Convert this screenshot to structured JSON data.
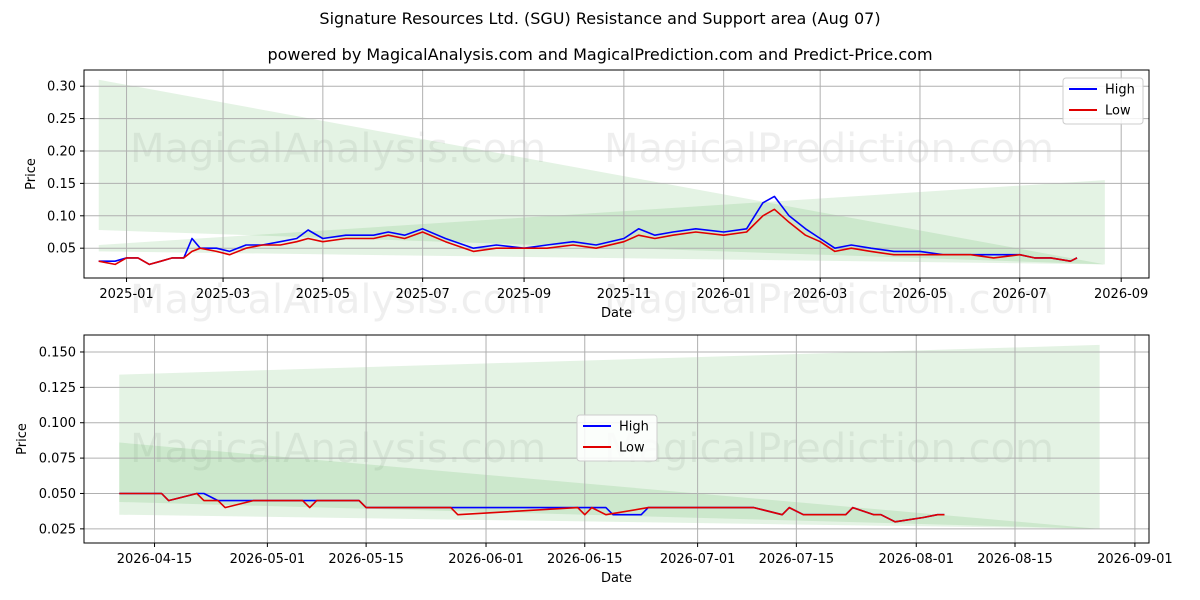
{
  "title": "Signature Resources Ltd. (SGU) Resistance and Support area (Aug 07)",
  "subtitle": "powered by MagicalAnalysis.com and MagicalPrediction.com and Predict-Price.com",
  "watermarks": [
    "MagicalAnalysis.com",
    "MagicalPrediction.com"
  ],
  "colors": {
    "high": "#0000ff",
    "low": "#e00000",
    "band": "#2ca02c",
    "grid": "#b0b0b0"
  },
  "chart_data": [
    {
      "type": "line",
      "xlabel": "Date",
      "ylabel": "Price",
      "x_type": "date",
      "xlim": [
        "2024-12-06",
        "2026-09-18"
      ],
      "ylim": [
        0.004,
        0.325
      ],
      "xticks": [
        "2025-01",
        "2025-03",
        "2025-05",
        "2025-07",
        "2025-09",
        "2025-11",
        "2026-01",
        "2026-03",
        "2026-05",
        "2026-07",
        "2026-09"
      ],
      "xtick_dates": [
        "2025-01-01",
        "2025-03-01",
        "2025-05-01",
        "2025-07-01",
        "2025-09-01",
        "2025-11-01",
        "2026-01-01",
        "2026-03-01",
        "2026-05-01",
        "2026-07-01",
        "2026-09-01"
      ],
      "yticks": [
        0.05,
        0.1,
        0.15,
        0.2,
        0.25,
        0.3
      ],
      "ytick_labels": [
        "0.05",
        "0.10",
        "0.15",
        "0.20",
        "0.25",
        "0.30"
      ],
      "grid": true,
      "legend_position": "top-right",
      "bands": [
        {
          "x": [
            "2024-12-15",
            "2026-08-22"
          ],
          "upper": [
            0.31,
            0.025
          ],
          "lower": [
            0.078,
            0.025
          ]
        },
        {
          "x": [
            "2024-12-15",
            "2026-08-22"
          ],
          "upper": [
            0.055,
            0.155
          ],
          "lower": [
            0.045,
            0.025
          ]
        }
      ],
      "series": [
        {
          "name": "High",
          "x": [
            "2024-12-15",
            "2024-12-25",
            "2025-01-01",
            "2025-01-08",
            "2025-01-15",
            "2025-01-22",
            "2025-01-29",
            "2025-02-05",
            "2025-02-10",
            "2025-02-15",
            "2025-02-25",
            "2025-03-05",
            "2025-03-15",
            "2025-03-25",
            "2025-04-05",
            "2025-04-15",
            "2025-04-22",
            "2025-05-01",
            "2025-05-15",
            "2025-06-01",
            "2025-06-10",
            "2025-06-20",
            "2025-07-01",
            "2025-07-15",
            "2025-08-01",
            "2025-08-15",
            "2025-09-01",
            "2025-09-15",
            "2025-10-01",
            "2025-10-15",
            "2025-11-01",
            "2025-11-10",
            "2025-11-20",
            "2025-12-01",
            "2025-12-15",
            "2026-01-01",
            "2026-01-15",
            "2026-01-25",
            "2026-02-01",
            "2026-02-10",
            "2026-02-20",
            "2026-03-01",
            "2026-03-10",
            "2026-03-20",
            "2026-04-01",
            "2026-04-15",
            "2026-05-01",
            "2026-05-15",
            "2026-06-01",
            "2026-06-15",
            "2026-07-01",
            "2026-07-10",
            "2026-07-20",
            "2026-08-01",
            "2026-08-05"
          ],
          "y": [
            0.03,
            0.03,
            0.035,
            0.035,
            0.025,
            0.03,
            0.035,
            0.035,
            0.065,
            0.05,
            0.05,
            0.045,
            0.055,
            0.055,
            0.06,
            0.065,
            0.078,
            0.065,
            0.07,
            0.07,
            0.075,
            0.07,
            0.08,
            0.065,
            0.05,
            0.055,
            0.05,
            0.055,
            0.06,
            0.055,
            0.065,
            0.08,
            0.07,
            0.075,
            0.08,
            0.075,
            0.08,
            0.12,
            0.13,
            0.1,
            0.08,
            0.065,
            0.05,
            0.055,
            0.05,
            0.045,
            0.045,
            0.04,
            0.04,
            0.04,
            0.04,
            0.035,
            0.035,
            0.03,
            0.035
          ]
        },
        {
          "name": "Low",
          "x": [
            "2024-12-15",
            "2024-12-25",
            "2025-01-01",
            "2025-01-08",
            "2025-01-15",
            "2025-01-22",
            "2025-01-29",
            "2025-02-05",
            "2025-02-10",
            "2025-02-15",
            "2025-02-25",
            "2025-03-05",
            "2025-03-15",
            "2025-03-25",
            "2025-04-05",
            "2025-04-15",
            "2025-04-22",
            "2025-05-01",
            "2025-05-15",
            "2025-06-01",
            "2025-06-10",
            "2025-06-20",
            "2025-07-01",
            "2025-07-15",
            "2025-08-01",
            "2025-08-15",
            "2025-09-01",
            "2025-09-15",
            "2025-10-01",
            "2025-10-15",
            "2025-11-01",
            "2025-11-10",
            "2025-11-20",
            "2025-12-01",
            "2025-12-15",
            "2026-01-01",
            "2026-01-15",
            "2026-01-25",
            "2026-02-01",
            "2026-02-10",
            "2026-02-20",
            "2026-03-01",
            "2026-03-10",
            "2026-03-20",
            "2026-04-01",
            "2026-04-15",
            "2026-05-01",
            "2026-05-15",
            "2026-06-01",
            "2026-06-15",
            "2026-07-01",
            "2026-07-10",
            "2026-07-20",
            "2026-08-01",
            "2026-08-05"
          ],
          "y": [
            0.03,
            0.025,
            0.035,
            0.035,
            0.025,
            0.03,
            0.035,
            0.035,
            0.045,
            0.05,
            0.045,
            0.04,
            0.05,
            0.055,
            0.055,
            0.06,
            0.065,
            0.06,
            0.065,
            0.065,
            0.07,
            0.065,
            0.075,
            0.06,
            0.045,
            0.05,
            0.05,
            0.05,
            0.055,
            0.05,
            0.06,
            0.07,
            0.065,
            0.07,
            0.075,
            0.07,
            0.075,
            0.1,
            0.11,
            0.09,
            0.07,
            0.06,
            0.045,
            0.05,
            0.045,
            0.04,
            0.04,
            0.04,
            0.04,
            0.035,
            0.04,
            0.035,
            0.035,
            0.03,
            0.035
          ]
        }
      ]
    },
    {
      "type": "line",
      "xlabel": "Date",
      "ylabel": "Price",
      "x_type": "date",
      "xlim": [
        "2026-04-05",
        "2026-09-03"
      ],
      "ylim": [
        0.015,
        0.162
      ],
      "xticks": [
        "2026-04-15",
        "2026-05-01",
        "2026-05-15",
        "2026-06-01",
        "2026-06-15",
        "2026-07-01",
        "2026-07-15",
        "2026-08-01",
        "2026-08-15",
        "2026-09-01"
      ],
      "yticks": [
        0.025,
        0.05,
        0.075,
        0.1,
        0.125,
        0.15
      ],
      "ytick_labels": [
        "0.025",
        "0.050",
        "0.075",
        "0.100",
        "0.125",
        "0.150"
      ],
      "grid": true,
      "legend_position": "center-left",
      "bands": [
        {
          "x": [
            "2026-04-10",
            "2026-08-27"
          ],
          "upper": [
            0.134,
            0.155
          ],
          "lower": [
            0.044,
            0.025
          ]
        },
        {
          "x": [
            "2026-04-10",
            "2026-08-27"
          ],
          "upper": [
            0.086,
            0.025
          ],
          "lower": [
            0.035,
            0.025
          ]
        }
      ],
      "series": [
        {
          "name": "High",
          "x": [
            "2026-04-10",
            "2026-04-16",
            "2026-04-17",
            "2026-04-21",
            "2026-04-22",
            "2026-04-24",
            "2026-04-25",
            "2026-04-29",
            "2026-05-07",
            "2026-05-08",
            "2026-05-12",
            "2026-05-14",
            "2026-05-15",
            "2026-06-08",
            "2026-06-16",
            "2026-06-18",
            "2026-06-19",
            "2026-06-23",
            "2026-06-24",
            "2026-07-09",
            "2026-07-13",
            "2026-07-14",
            "2026-07-16",
            "2026-07-21",
            "2026-07-22",
            "2026-07-23",
            "2026-07-26",
            "2026-07-27",
            "2026-07-29",
            "2026-08-02",
            "2026-08-04",
            "2026-08-05"
          ],
          "y": [
            0.05,
            0.05,
            0.045,
            0.05,
            0.05,
            0.045,
            0.045,
            0.045,
            0.045,
            0.045,
            0.045,
            0.045,
            0.04,
            0.04,
            0.04,
            0.04,
            0.035,
            0.035,
            0.04,
            0.04,
            0.035,
            0.04,
            0.035,
            0.035,
            0.035,
            0.04,
            0.035,
            0.035,
            0.03,
            0.033,
            0.035,
            0.035
          ]
        },
        {
          "name": "Low",
          "x": [
            "2026-04-10",
            "2026-04-16",
            "2026-04-17",
            "2026-04-21",
            "2026-04-22",
            "2026-04-24",
            "2026-04-25",
            "2026-04-29",
            "2026-05-06",
            "2026-05-07",
            "2026-05-08",
            "2026-05-14",
            "2026-05-15",
            "2026-05-27",
            "2026-05-28",
            "2026-06-14",
            "2026-06-15",
            "2026-06-16",
            "2026-06-18",
            "2026-06-24",
            "2026-07-09",
            "2026-07-13",
            "2026-07-14",
            "2026-07-16",
            "2026-07-21",
            "2026-07-22",
            "2026-07-23",
            "2026-07-26",
            "2026-07-27",
            "2026-07-29",
            "2026-08-02",
            "2026-08-04",
            "2026-08-05"
          ],
          "y": [
            0.05,
            0.05,
            0.045,
            0.05,
            0.045,
            0.045,
            0.04,
            0.045,
            0.045,
            0.04,
            0.045,
            0.045,
            0.04,
            0.04,
            0.035,
            0.04,
            0.035,
            0.04,
            0.035,
            0.04,
            0.04,
            0.035,
            0.04,
            0.035,
            0.035,
            0.035,
            0.04,
            0.035,
            0.035,
            0.03,
            0.033,
            0.035,
            0.035
          ]
        }
      ]
    }
  ]
}
